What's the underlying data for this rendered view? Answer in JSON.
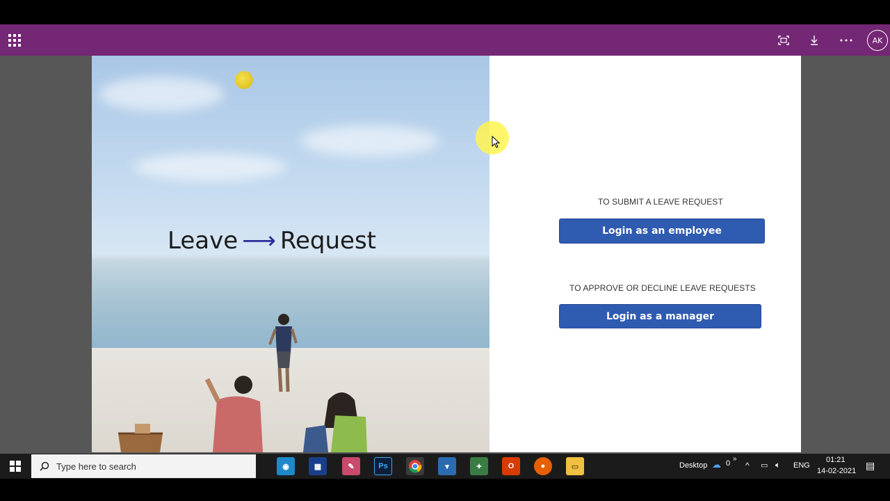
{
  "appbar": {
    "avatar_initials": "AK",
    "icons": [
      "waffle-icon",
      "fullscreen-icon",
      "download-icon",
      "more-icon"
    ],
    "bg_color": "#742774"
  },
  "hero": {
    "title_left": "Leave",
    "arrow": "⟶",
    "title_right": "Request"
  },
  "panel": {
    "employee_caption": "TO SUBMIT A LEAVE REQUEST",
    "employee_button": "Login as an employee",
    "manager_caption": "TO APPROVE OR DECLINE LEAVE REQUESTS",
    "manager_button": "Login as a manager",
    "button_color": "#2f5bb1"
  },
  "taskbar": {
    "search_placeholder": "Type here to search",
    "desktop_label": "Desktop",
    "onedrive_count": "0",
    "language": "ENG",
    "time": "01:21",
    "date": "14-02-2021"
  }
}
